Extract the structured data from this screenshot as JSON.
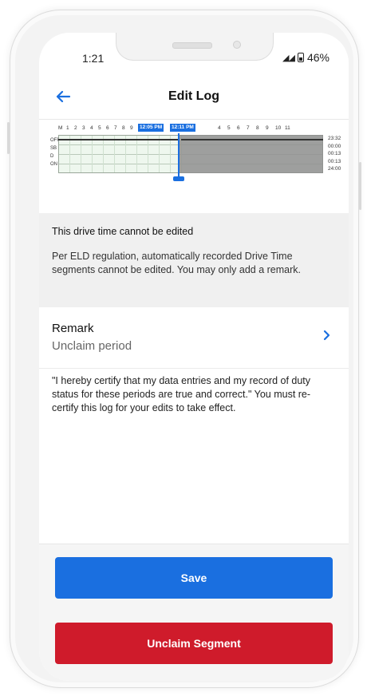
{
  "status_bar": {
    "time": "1:21",
    "battery": "46%"
  },
  "header": {
    "title": "Edit Log"
  },
  "graph": {
    "hour_labels": [
      "M",
      "1",
      "2",
      "3",
      "4",
      "5",
      "6",
      "7",
      "8",
      "9",
      "4",
      "5",
      "6",
      "7",
      "8",
      "9",
      "10",
      "11"
    ],
    "start_tag": "12:05 PM",
    "end_tag": "12:11 PM",
    "rows": [
      "OFF",
      "SB",
      "D",
      "ON"
    ],
    "totals": [
      "23:32",
      "00:00",
      "00:13",
      "00:13",
      "24:00"
    ]
  },
  "notice": {
    "title": "This drive time cannot be edited",
    "body": "Per ELD regulation, automatically recorded Drive Time segments cannot be edited. You may only add a remark."
  },
  "remark": {
    "label": "Remark",
    "value": "Unclaim period"
  },
  "certify_text": "\"I hereby certify that my data entries and my record of duty status for these periods are true and correct.\" You must re-certify this log for your edits to take effect.",
  "buttons": {
    "save": "Save",
    "unclaim": "Unclaim Segment"
  },
  "colors": {
    "accent": "#1a6fe0",
    "danger": "#cf1b2b"
  }
}
